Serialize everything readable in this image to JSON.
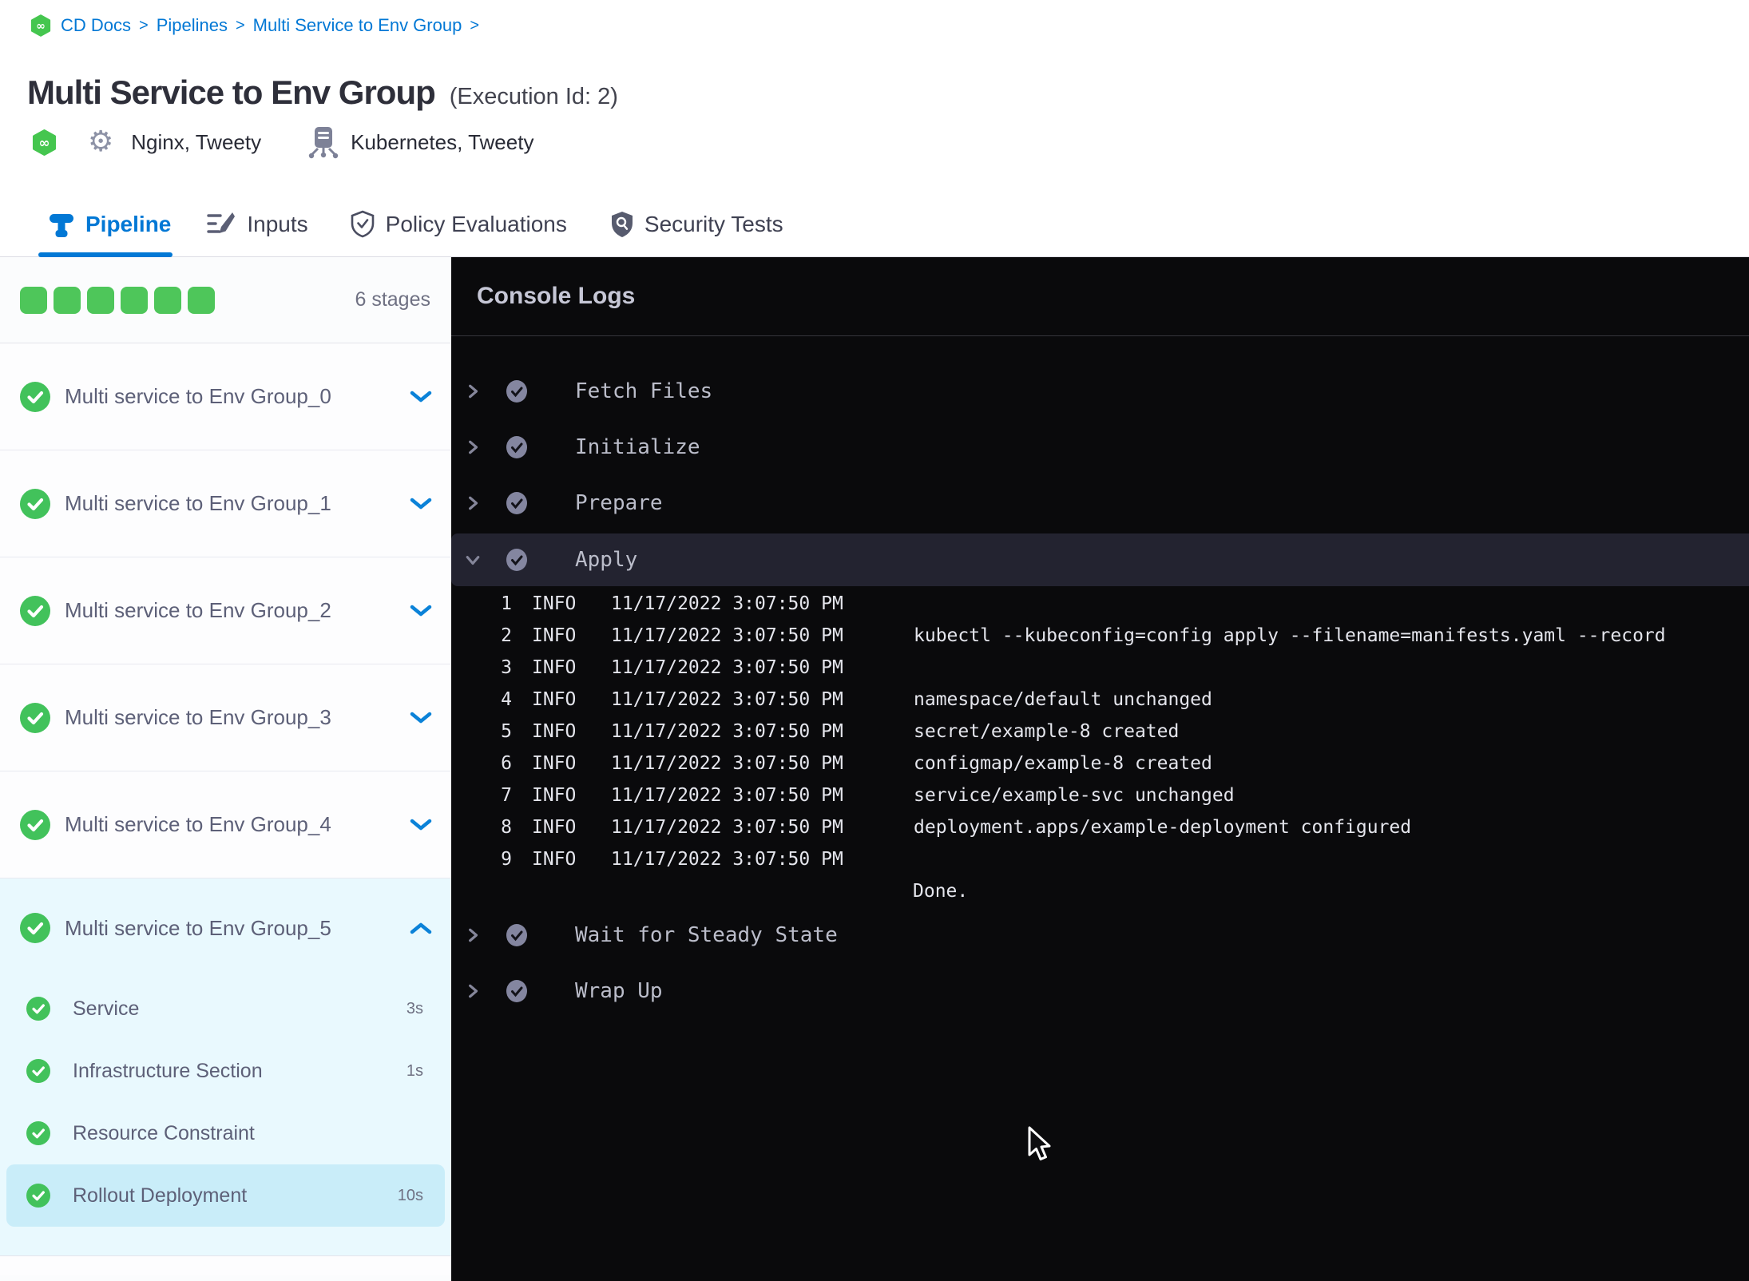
{
  "breadcrumb": {
    "items": [
      "CD Docs",
      "Pipelines",
      "Multi Service to Env Group"
    ],
    "separator": ">"
  },
  "header": {
    "title": "Multi Service to Env Group",
    "execution_id": "(Execution Id: 2)",
    "services": "Nginx, Tweety",
    "environments": "Kubernetes, Tweety"
  },
  "tabs": {
    "pipeline": "Pipeline",
    "inputs": "Inputs",
    "policy": "Policy Evaluations",
    "security": "Security Tests",
    "active": "Pipeline"
  },
  "sidebar": {
    "stage_count": "6 stages",
    "stages": [
      "Multi service to Env Group_0",
      "Multi service to Env Group_1",
      "Multi service to Env Group_2",
      "Multi service to Env Group_3",
      "Multi service to Env Group_4"
    ],
    "expanded_stage": {
      "label": "Multi service to Env Group_5",
      "steps": [
        {
          "label": "Service",
          "duration": "3s"
        },
        {
          "label": "Infrastructure Section",
          "duration": "1s"
        },
        {
          "label": "Resource Constraint",
          "duration": ""
        },
        {
          "label": "Rollout Deployment",
          "duration": "10s",
          "selected": true
        }
      ]
    }
  },
  "console": {
    "title": "Console Logs",
    "steps_before": [
      "Fetch Files",
      "Initialize",
      "Prepare"
    ],
    "expanded_step": "Apply",
    "steps_after": [
      "Wait for Steady State",
      "Wrap Up"
    ],
    "logs": [
      {
        "n": "1",
        "lvl": "INFO",
        "time": "11/17/2022 3:07:50 PM",
        "msg": ""
      },
      {
        "n": "2",
        "lvl": "INFO",
        "time": "11/17/2022 3:07:50 PM",
        "msg": "kubectl --kubeconfig=config apply --filename=manifests.yaml --record"
      },
      {
        "n": "3",
        "lvl": "INFO",
        "time": "11/17/2022 3:07:50 PM",
        "msg": ""
      },
      {
        "n": "4",
        "lvl": "INFO",
        "time": "11/17/2022 3:07:50 PM",
        "msg": "namespace/default unchanged"
      },
      {
        "n": "5",
        "lvl": "INFO",
        "time": "11/17/2022 3:07:50 PM",
        "msg": "secret/example-8 created"
      },
      {
        "n": "6",
        "lvl": "INFO",
        "time": "11/17/2022 3:07:50 PM",
        "msg": "configmap/example-8 created"
      },
      {
        "n": "7",
        "lvl": "INFO",
        "time": "11/17/2022 3:07:50 PM",
        "msg": "service/example-svc unchanged"
      },
      {
        "n": "8",
        "lvl": "INFO",
        "time": "11/17/2022 3:07:50 PM",
        "msg": "deployment.apps/example-deployment configured"
      },
      {
        "n": "9",
        "lvl": "INFO",
        "time": "11/17/2022 3:07:50 PM",
        "msg": ""
      }
    ],
    "done": "Done."
  },
  "colors": {
    "brand_blue": "#0278d5",
    "chevron_blue": "#0b82d8",
    "success_green": "#42c25b",
    "squares_green": "#4ec65a",
    "console_bg": "#0a0a0c",
    "expanded_step_bg": "#232330",
    "stage_group_bg": "#e9f9fe",
    "selected_step_bg": "#c9edf9"
  }
}
